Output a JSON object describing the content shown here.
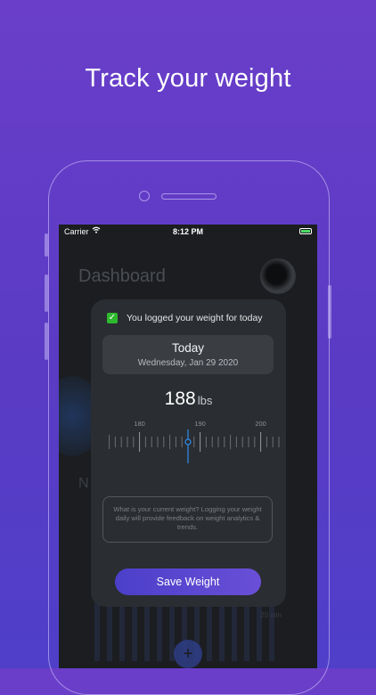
{
  "headline": "Track your weight",
  "status_bar": {
    "carrier": "Carrier",
    "time": "8:12 PM"
  },
  "background": {
    "title": "Dashboard",
    "letter": "N",
    "minutes": "20 min"
  },
  "modal": {
    "confirmation": "You logged your weight for today",
    "date_title": "Today",
    "date_subtitle": "Wednesday, Jan 29 2020",
    "weight_value": "188",
    "weight_unit": "lbs",
    "ruler": {
      "labels": [
        "180",
        "190",
        "200"
      ],
      "min": 175,
      "max": 205,
      "selected": 188
    },
    "hint": "What is your current weight? Logging your weight daily will provide feedback on weight analytics & trends.",
    "save_label": "Save Weight"
  },
  "colors": {
    "accent": "#5b46d0",
    "check": "#2eb82e",
    "background_top": "#6a3ec9"
  }
}
